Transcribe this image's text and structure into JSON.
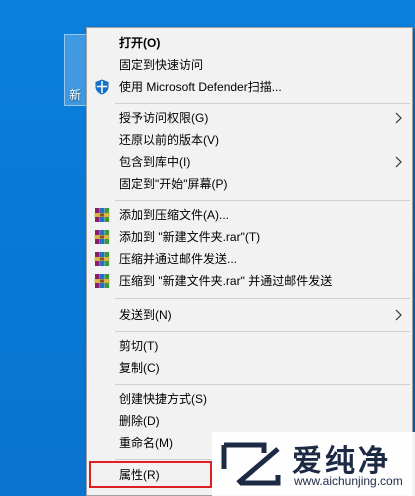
{
  "desktop": {
    "folder_label": "新"
  },
  "menu": {
    "items": [
      {
        "label": "打开(O)"
      },
      {
        "label": "固定到快速访问"
      },
      {
        "label": "使用 Microsoft Defender扫描..."
      },
      {
        "label": "授予访问权限(G)"
      },
      {
        "label": "还原以前的版本(V)"
      },
      {
        "label": "包含到库中(I)"
      },
      {
        "label": "固定到\"开始\"屏幕(P)"
      },
      {
        "label": "添加到压缩文件(A)..."
      },
      {
        "label": "添加到 \"新建文件夹.rar\"(T)"
      },
      {
        "label": "压缩并通过邮件发送..."
      },
      {
        "label": "压缩到 \"新建文件夹.rar\" 并通过邮件发送"
      },
      {
        "label": "发送到(N)"
      },
      {
        "label": "剪切(T)"
      },
      {
        "label": "复制(C)"
      },
      {
        "label": "创建快捷方式(S)"
      },
      {
        "label": "删除(D)"
      },
      {
        "label": "重命名(M)"
      },
      {
        "label": "属性(R)"
      }
    ]
  },
  "watermark": {
    "title": "爱纯净",
    "subtitle": "www.aichunjing.com"
  },
  "colors": {
    "desktop": "#0a78d7",
    "menu_bg": "#f2f2f2",
    "highlight": "#e02020"
  }
}
